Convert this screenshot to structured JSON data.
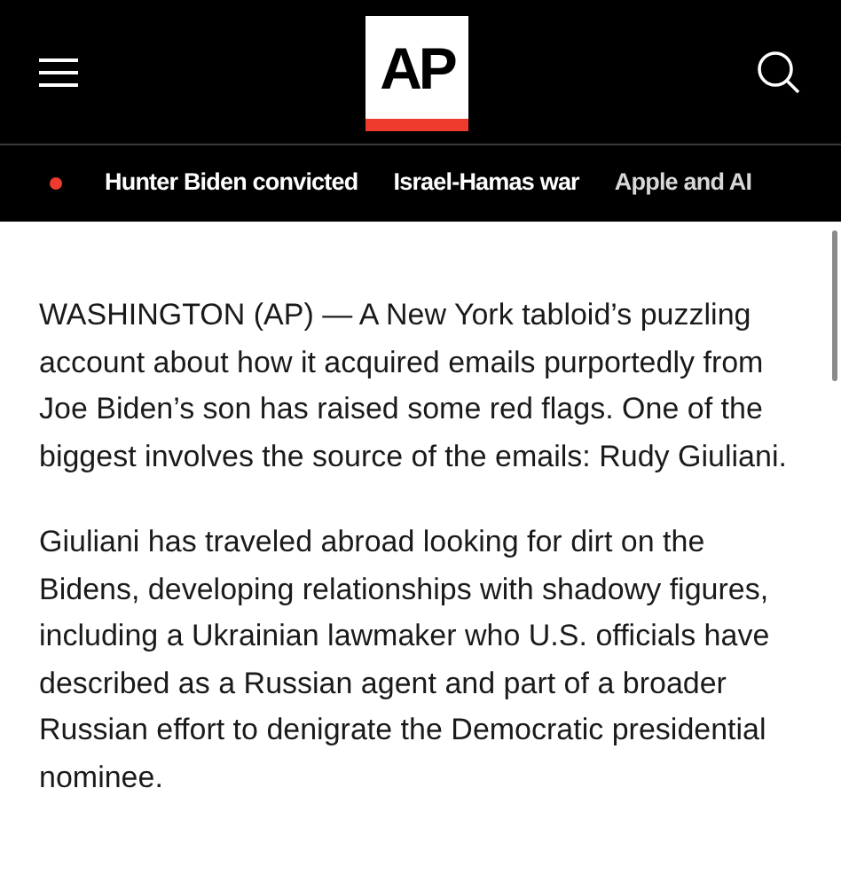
{
  "header": {
    "logo": "AP"
  },
  "nav": {
    "items": [
      {
        "label": "Hunter Biden convicted"
      },
      {
        "label": "Israel-Hamas war"
      },
      {
        "label": "Apple and AI"
      }
    ]
  },
  "article": {
    "paragraphs": [
      "WASHINGTON (AP) — A New York tabloid’s puzzling account about how it acquired emails purportedly from Joe Biden’s son has raised some red flags. One of the biggest involves the source of the emails: Rudy Giuliani.",
      "Giuliani has traveled abroad looking for dirt on the Bidens, developing relationships with shadowy figures, including a Ukrainian lawmaker who U.S. officials have described as a Russian agent and part of a broader Russian effort to denigrate the Democratic presidential nominee."
    ]
  }
}
